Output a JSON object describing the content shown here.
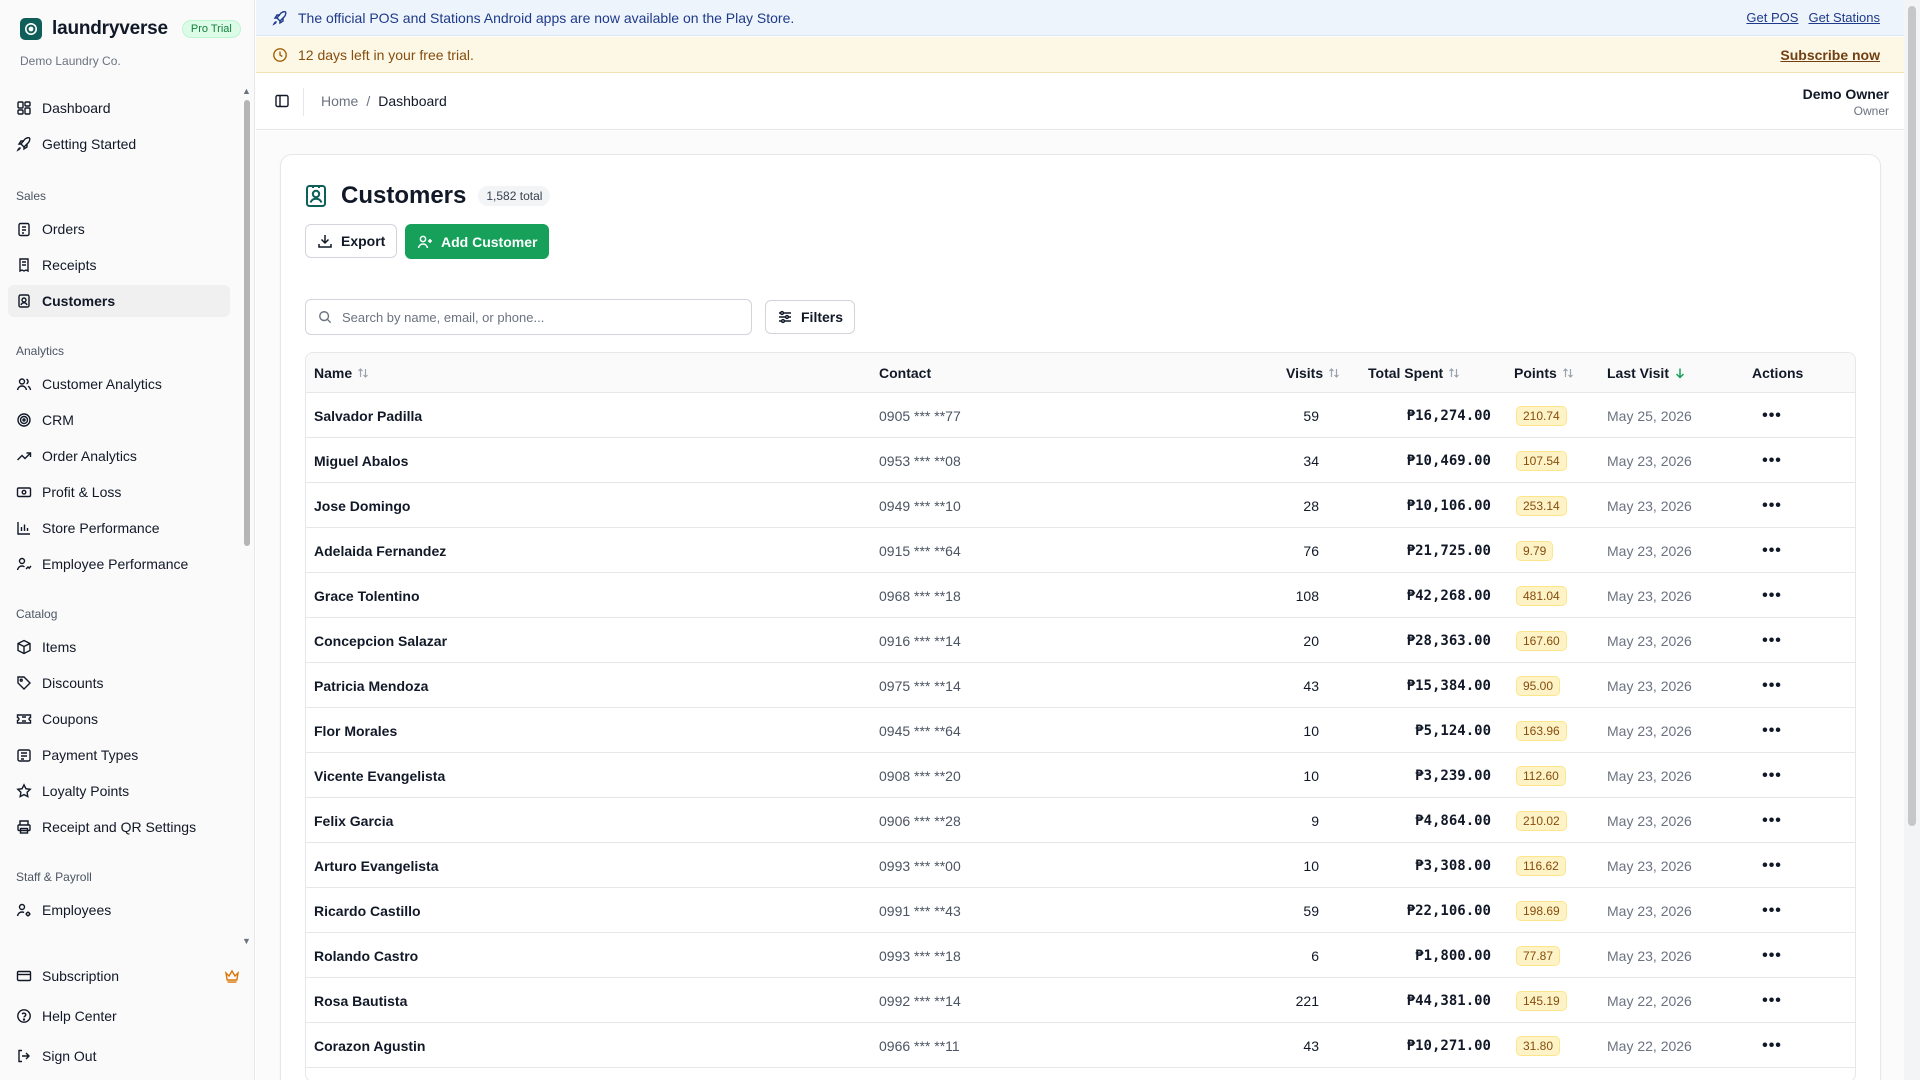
{
  "brand": {
    "name": "laundryverse",
    "badge": "Pro Trial",
    "org": "Demo Laundry Co."
  },
  "sidebar": {
    "top_items": [
      {
        "label": "Dashboard",
        "icon": "dashboard-icon"
      },
      {
        "label": "Getting Started",
        "icon": "rocket-icon"
      }
    ],
    "groups": [
      {
        "label": "Sales",
        "items": [
          {
            "label": "Orders",
            "icon": "clipboard-icon"
          },
          {
            "label": "Receipts",
            "icon": "receipt-icon"
          },
          {
            "label": "Customers",
            "icon": "contact-icon",
            "active": true
          }
        ]
      },
      {
        "label": "Analytics",
        "items": [
          {
            "label": "Customer Analytics",
            "icon": "users-icon"
          },
          {
            "label": "CRM",
            "icon": "target-icon"
          },
          {
            "label": "Order Analytics",
            "icon": "trending-up-icon"
          },
          {
            "label": "Profit & Loss",
            "icon": "banknote-icon"
          },
          {
            "label": "Store Performance",
            "icon": "bar-chart-icon"
          },
          {
            "label": "Employee Performance",
            "icon": "user-chart-icon"
          }
        ]
      },
      {
        "label": "Catalog",
        "items": [
          {
            "label": "Items",
            "icon": "package-icon"
          },
          {
            "label": "Discounts",
            "icon": "tag-icon"
          },
          {
            "label": "Coupons",
            "icon": "ticket-icon"
          },
          {
            "label": "Payment Types",
            "icon": "wallet-icon"
          },
          {
            "label": "Loyalty Points",
            "icon": "star-icon"
          },
          {
            "label": "Receipt and QR Settings",
            "icon": "printer-icon"
          }
        ]
      },
      {
        "label": "Staff & Payroll",
        "items": [
          {
            "label": "Employees",
            "icon": "user-cog-icon"
          }
        ]
      }
    ],
    "bottom_items": [
      {
        "label": "Subscription",
        "icon": "credit-card-icon"
      },
      {
        "label": "Help Center",
        "icon": "help-circle-icon"
      },
      {
        "label": "Sign Out",
        "icon": "log-out-icon"
      }
    ]
  },
  "announcement": {
    "text": "The official POS and Stations Android apps are now available on the Play Store.",
    "link_pos": "Get POS",
    "link_stations": "Get Stations"
  },
  "trial": {
    "text": "12 days left in your free trial.",
    "cta": "Subscribe now"
  },
  "breadcrumb": {
    "home": "Home",
    "separator": "/",
    "current": "Dashboard"
  },
  "user": {
    "name": "Demo Owner",
    "role": "Owner"
  },
  "page": {
    "title": "Customers",
    "count": "1,582 total",
    "export_label": "Export",
    "add_label": "Add Customer"
  },
  "search": {
    "placeholder": "Search by name, email, or phone...",
    "value": ""
  },
  "filters_label": "Filters",
  "table": {
    "columns": {
      "name": "Name",
      "contact": "Contact",
      "visits": "Visits",
      "total_spent": "Total Spent",
      "points": "Points",
      "last_visit": "Last Visit",
      "actions": "Actions"
    },
    "sort": {
      "column": "last_visit",
      "direction": "desc"
    },
    "rows": [
      {
        "name": "Salvador Padilla",
        "contact": "0905 *** **77",
        "visits": "59",
        "spent": "₱16,274.00",
        "points": "210.74",
        "last": "May 25, 2026"
      },
      {
        "name": "Miguel Abalos",
        "contact": "0953 *** **08",
        "visits": "34",
        "spent": "₱10,469.00",
        "points": "107.54",
        "last": "May 23, 2026"
      },
      {
        "name": "Jose Domingo",
        "contact": "0949 *** **10",
        "visits": "28",
        "spent": "₱10,106.00",
        "points": "253.14",
        "last": "May 23, 2026"
      },
      {
        "name": "Adelaida Fernandez",
        "contact": "0915 *** **64",
        "visits": "76",
        "spent": "₱21,725.00",
        "points": "9.79",
        "last": "May 23, 2026"
      },
      {
        "name": "Grace Tolentino",
        "contact": "0968 *** **18",
        "visits": "108",
        "spent": "₱42,268.00",
        "points": "481.04",
        "last": "May 23, 2026"
      },
      {
        "name": "Concepcion Salazar",
        "contact": "0916 *** **14",
        "visits": "20",
        "spent": "₱28,363.00",
        "points": "167.60",
        "last": "May 23, 2026"
      },
      {
        "name": "Patricia Mendoza",
        "contact": "0975 *** **14",
        "visits": "43",
        "spent": "₱15,384.00",
        "points": "95.00",
        "last": "May 23, 2026"
      },
      {
        "name": "Flor Morales",
        "contact": "0945 *** **64",
        "visits": "10",
        "spent": "₱5,124.00",
        "points": "163.96",
        "last": "May 23, 2026"
      },
      {
        "name": "Vicente Evangelista",
        "contact": "0908 *** **20",
        "visits": "10",
        "spent": "₱3,239.00",
        "points": "112.60",
        "last": "May 23, 2026"
      },
      {
        "name": "Felix Garcia",
        "contact": "0906 *** **28",
        "visits": "9",
        "spent": "₱4,864.00",
        "points": "210.02",
        "last": "May 23, 2026"
      },
      {
        "name": "Arturo Evangelista",
        "contact": "0993 *** **00",
        "visits": "10",
        "spent": "₱3,308.00",
        "points": "116.62",
        "last": "May 23, 2026"
      },
      {
        "name": "Ricardo Castillo",
        "contact": "0991 *** **43",
        "visits": "59",
        "spent": "₱22,106.00",
        "points": "198.69",
        "last": "May 23, 2026"
      },
      {
        "name": "Rolando Castro",
        "contact": "0993 *** **18",
        "visits": "6",
        "spent": "₱1,800.00",
        "points": "77.87",
        "last": "May 23, 2026"
      },
      {
        "name": "Rosa Bautista",
        "contact": "0992 *** **14",
        "visits": "221",
        "spent": "₱44,381.00",
        "points": "145.19",
        "last": "May 22, 2026"
      },
      {
        "name": "Corazon Agustin",
        "contact": "0966 *** **11",
        "visits": "43",
        "spent": "₱10,271.00",
        "points": "31.80",
        "last": "May 22, 2026"
      }
    ],
    "actions_glyph": "•••"
  },
  "colors": {
    "brand": "#0f5e5a",
    "primary": "#16a05a",
    "announce_bg": "#eef4fb",
    "trial_bg": "#fdf8e6"
  }
}
